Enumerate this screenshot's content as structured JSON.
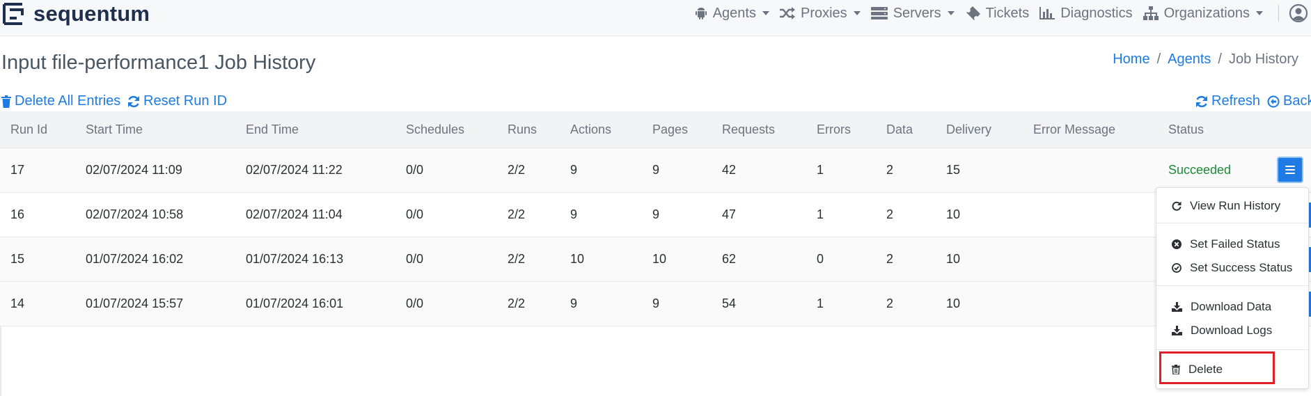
{
  "navbar": {
    "brand": "sequentum",
    "items": [
      {
        "label": "Agents",
        "icon": "android-icon",
        "has_caret": true
      },
      {
        "label": "Proxies",
        "icon": "shuffle-icon",
        "has_caret": true
      },
      {
        "label": "Servers",
        "icon": "server-icon",
        "has_caret": true
      },
      {
        "label": "Tickets",
        "icon": "ticket-icon",
        "has_caret": false
      },
      {
        "label": "Diagnostics",
        "icon": "bar-chart-icon",
        "has_caret": false
      },
      {
        "label": "Organizations",
        "icon": "sitemap-icon",
        "has_caret": true
      }
    ],
    "user_icon": "user-circle-icon"
  },
  "page": {
    "title": "Input file-performance1 Job History"
  },
  "breadcrumb": {
    "home": "Home",
    "agents": "Agents",
    "current": "Job History",
    "separator": "/"
  },
  "toolbar": {
    "delete_all": "Delete All Entries",
    "reset_run_id": "Reset Run ID",
    "refresh": "Refresh",
    "back": "Back"
  },
  "table": {
    "headers": {
      "run_id": "Run Id",
      "start_time": "Start Time",
      "end_time": "End Time",
      "schedules": "Schedules",
      "runs": "Runs",
      "actions": "Actions",
      "pages": "Pages",
      "requests": "Requests",
      "errors": "Errors",
      "data": "Data",
      "delivery": "Delivery",
      "error_message": "Error Message",
      "status": "Status"
    },
    "rows": [
      {
        "run_id": "17",
        "start_time": "02/07/2024 11:09",
        "end_time": "02/07/2024 11:22",
        "schedules": "0/0",
        "runs": "2/2",
        "actions": "9",
        "pages": "9",
        "requests": "42",
        "errors": "1",
        "data": "2",
        "delivery": "15",
        "error_message": "",
        "status": "Succeeded"
      },
      {
        "run_id": "16",
        "start_time": "02/07/2024 10:58",
        "end_time": "02/07/2024 11:04",
        "schedules": "0/0",
        "runs": "2/2",
        "actions": "9",
        "pages": "9",
        "requests": "47",
        "errors": "1",
        "data": "2",
        "delivery": "10",
        "error_message": "",
        "status": ""
      },
      {
        "run_id": "15",
        "start_time": "01/07/2024 16:02",
        "end_time": "01/07/2024 16:13",
        "schedules": "0/0",
        "runs": "2/2",
        "actions": "10",
        "pages": "10",
        "requests": "62",
        "errors": "0",
        "data": "2",
        "delivery": "10",
        "error_message": "",
        "status": ""
      },
      {
        "run_id": "14",
        "start_time": "01/07/2024 15:57",
        "end_time": "01/07/2024 16:01",
        "schedules": "0/0",
        "runs": "2/2",
        "actions": "9",
        "pages": "9",
        "requests": "54",
        "errors": "1",
        "data": "2",
        "delivery": "10",
        "error_message": "",
        "status": ""
      }
    ]
  },
  "dropdown": {
    "view_run_history": "View Run History",
    "set_failed_status": "Set Failed Status",
    "set_success_status": "Set Success Status",
    "download_data": "Download Data",
    "download_logs": "Download Logs",
    "delete": "Delete"
  },
  "colors": {
    "accent": "#1d7be3",
    "success": "#1e8a3a",
    "highlight": "#e01e25",
    "brand_text": "#1f2f4d"
  }
}
